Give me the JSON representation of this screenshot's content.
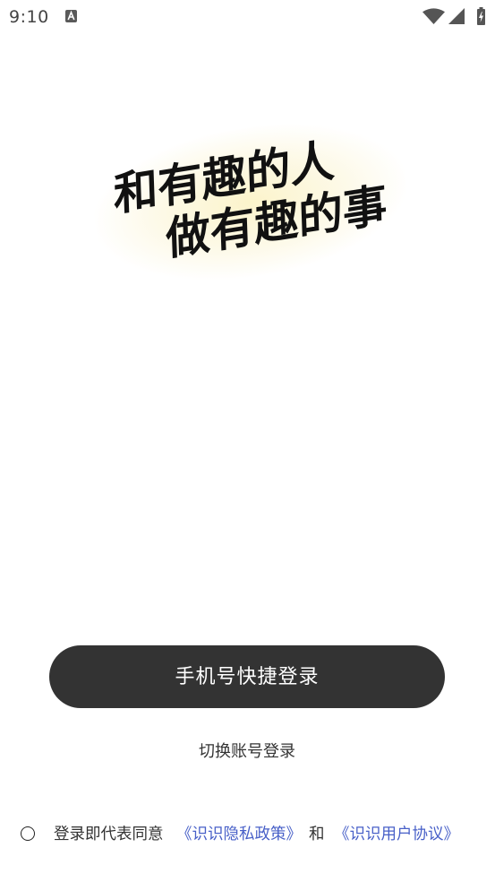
{
  "status_bar": {
    "time": "9:10",
    "icons": [
      "app-notification-icon",
      "wifi-icon",
      "signal-icon",
      "battery-charging-icon"
    ]
  },
  "logo": {
    "line1": "和有趣的人",
    "line2": "做有趣的事"
  },
  "actions": {
    "quick_login_label": "手机号快捷登录",
    "switch_account_label": "切换账号登录"
  },
  "agreement": {
    "checked": false,
    "prefix": "登录即代表同意",
    "privacy_link": "《识识隐私政策》",
    "conjunction": "和",
    "terms_link": "《识识用户协议》"
  },
  "colors": {
    "background": "#ffffff",
    "primary_button": "#333333",
    "link": "#4860c8",
    "text": "#333333",
    "logo_glow": "#fbf3c8"
  }
}
